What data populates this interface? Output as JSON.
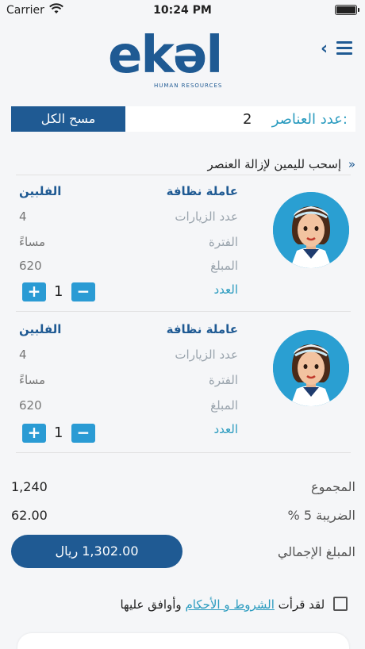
{
  "status": {
    "carrier": "Carrier",
    "time": "10:24 PM"
  },
  "header": {
    "logo_text": "ekəl",
    "logo_sub": "HUMAN RESOURCES"
  },
  "cart": {
    "clear_label": "مسح الكل",
    "count_label": "عدد العناصر:",
    "count_value": "2"
  },
  "hint": "إسحب لليمين لإزالة العنصر",
  "items": [
    {
      "title": "عاملة نظافة",
      "nationality": "الفلبين",
      "visits_label": "عدد الزيارات",
      "visits": "4",
      "period_label": "الفترة",
      "period": "مساءً",
      "amount_label": "المبلغ",
      "amount": "620",
      "qty_label": "العدد",
      "qty": "1"
    },
    {
      "title": "عاملة نظافة",
      "nationality": "الفلبين",
      "visits_label": "عدد الزيارات",
      "visits": "4",
      "period_label": "الفترة",
      "period": "مساءً",
      "amount_label": "المبلغ",
      "amount": "620",
      "qty_label": "العدد",
      "qty": "1"
    }
  ],
  "summary": {
    "subtotal_label": "المجموع",
    "subtotal": "1,240",
    "tax_label": "الضريبة 5 %",
    "tax": "62.00",
    "total_label": "المبلغ الإجمالي",
    "total": "1,302.00 ريال"
  },
  "terms": {
    "prefix": "لقد قرأت",
    "link": "الشروط و الأحكام",
    "suffix": "وأوافق عليها"
  },
  "colors": {
    "primary": "#1f5a93",
    "accent": "#2a9bbf",
    "button_blue": "#2a9bd4"
  }
}
